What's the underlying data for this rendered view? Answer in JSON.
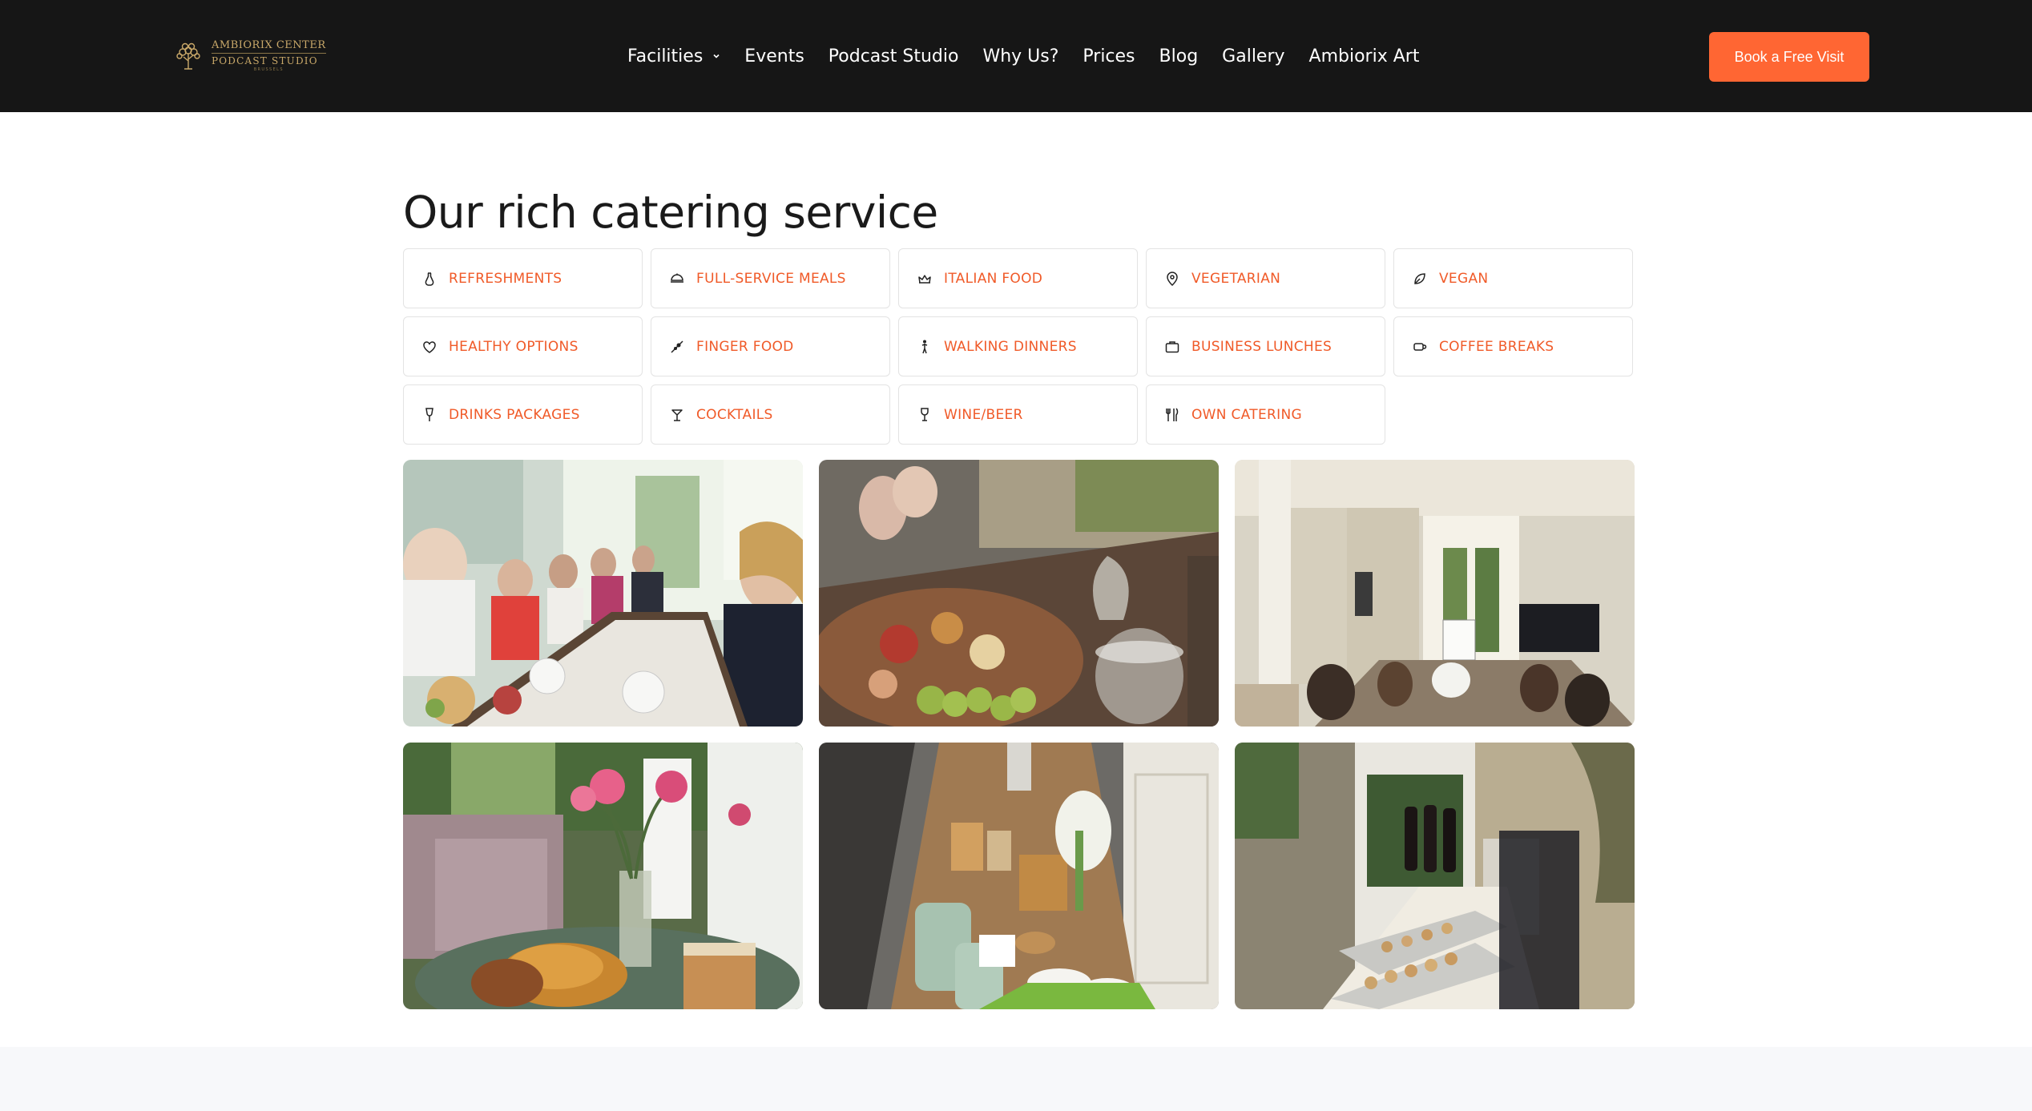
{
  "header": {
    "logo": {
      "line1": "AMBIORIX CENTER",
      "line2": "PODCAST STUDIO",
      "line3": "BRUSSELS"
    },
    "nav": [
      {
        "label": "Facilities",
        "has_dropdown": true
      },
      {
        "label": "Events"
      },
      {
        "label": "Podcast Studio"
      },
      {
        "label": "Why Us?"
      },
      {
        "label": "Prices"
      },
      {
        "label": "Blog"
      },
      {
        "label": "Gallery"
      },
      {
        "label": "Ambiorix Art"
      }
    ],
    "cta_label": "Book a Free Visit"
  },
  "colors": {
    "header_bg": "#161616",
    "accent": "#ff6633",
    "tag_text": "#f05a28",
    "logo_gold": "#c9a869"
  },
  "section": {
    "title": "Our rich catering service",
    "tags": [
      {
        "label": "REFRESHMENTS",
        "icon": "flask-icon"
      },
      {
        "label": "FULL-SERVICE MEALS",
        "icon": "cloche-icon"
      },
      {
        "label": "ITALIAN FOOD",
        "icon": "crown-icon"
      },
      {
        "label": "VEGETARIAN",
        "icon": "map-pin-icon"
      },
      {
        "label": "VEGAN",
        "icon": "leaf-icon"
      },
      {
        "label": "HEALTHY OPTIONS",
        "icon": "heart-icon"
      },
      {
        "label": "FINGER FOOD",
        "icon": "skewer-icon"
      },
      {
        "label": "WALKING DINNERS",
        "icon": "person-walking-icon"
      },
      {
        "label": "BUSINESS LUNCHES",
        "icon": "briefcase-icon"
      },
      {
        "label": "COFFEE BREAKS",
        "icon": "coffee-cup-icon"
      },
      {
        "label": "DRINKS PACKAGES",
        "icon": "glass-icon"
      },
      {
        "label": "COCKTAILS",
        "icon": "cocktail-icon"
      },
      {
        "label": "WINE/BEER",
        "icon": "wine-glass-icon"
      },
      {
        "label": "OWN CATERING",
        "icon": "cutlery-icon"
      }
    ],
    "photos": [
      {
        "name": "photo-group-dinner"
      },
      {
        "name": "photo-buffet-table"
      },
      {
        "name": "photo-meeting-room"
      },
      {
        "name": "photo-croissant-coffee"
      },
      {
        "name": "photo-coffee-station"
      },
      {
        "name": "photo-wine-appetizers"
      }
    ]
  }
}
